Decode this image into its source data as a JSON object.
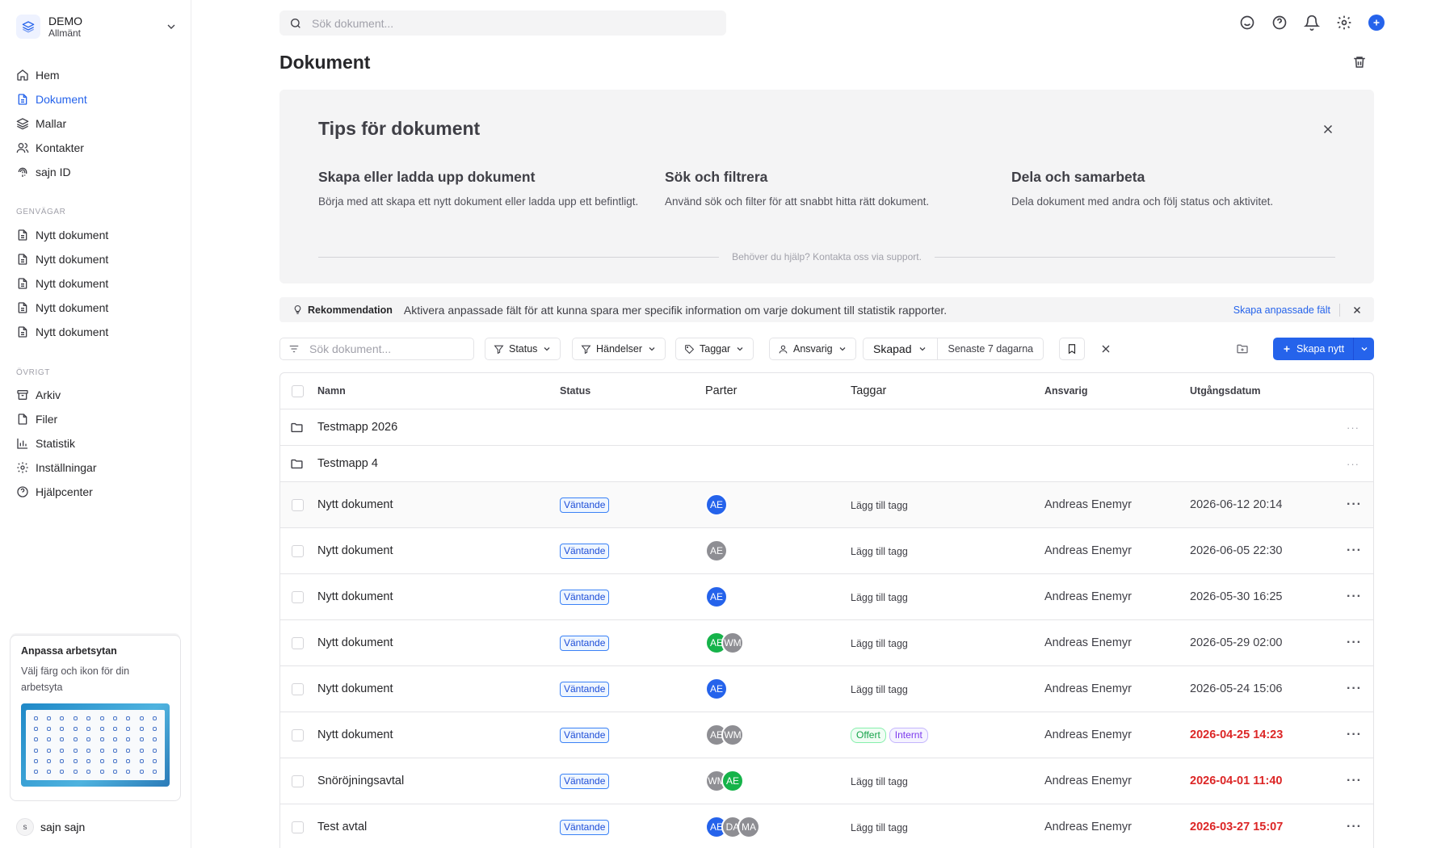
{
  "workspace": {
    "name": "DEMO",
    "sub": "Allmänt"
  },
  "nav": [
    {
      "label": "Hem",
      "icon": "home-icon"
    },
    {
      "label": "Dokument",
      "icon": "document-icon",
      "active": true
    },
    {
      "label": "Mallar",
      "icon": "layers-icon"
    },
    {
      "label": "Kontakter",
      "icon": "contacts-icon"
    },
    {
      "label": "sajn ID",
      "icon": "fingerprint-icon"
    }
  ],
  "shortcuts": {
    "label": "GENVÄGAR",
    "items": [
      "Nytt dokument",
      "Nytt dokument",
      "Nytt dokument",
      "Nytt dokument",
      "Nytt dokument"
    ]
  },
  "other": {
    "label": "ÖVRIGT",
    "items": [
      {
        "label": "Arkiv",
        "icon": "archive-icon"
      },
      {
        "label": "Filer",
        "icon": "file-icon"
      },
      {
        "label": "Statistik",
        "icon": "chart-icon"
      },
      {
        "label": "Inställningar",
        "icon": "gear-icon"
      },
      {
        "label": "Hjälpcenter",
        "icon": "help-icon"
      }
    ]
  },
  "customize_card": {
    "title": "Anpassa arbetsytan",
    "desc": "Välj färg och ikon för din arbetsyta"
  },
  "user": {
    "initial": "s",
    "name": "sajn sajn"
  },
  "top_search": {
    "placeholder": "Sök dokument..."
  },
  "page_title": "Dokument",
  "tips": {
    "title": "Tips för dokument",
    "columns": [
      {
        "title": "Skapa eller ladda upp dokument",
        "text": "Börja med att skapa ett nytt dokument eller ladda upp ett befintligt."
      },
      {
        "title": "Sök och filtrera",
        "text": "Använd sök och filter för att snabbt hitta rätt dokument."
      },
      {
        "title": "Dela och samarbeta",
        "text": "Dela dokument med andra och följ status och aktivitet."
      }
    ],
    "help": "Behöver du hjälp? Kontakta oss via support."
  },
  "recommendation": {
    "label": "Rekommendation",
    "message": "Aktivera anpassade fält för att kunna spara mer specifik information om varje dokument till statistik rapporter.",
    "link": "Skapa anpassade fält"
  },
  "filters": {
    "search_placeholder": "Sök dokument...",
    "status": "Status",
    "events": "Händelser",
    "tags": "Taggar",
    "responsible": "Ansvarig",
    "created": "Skapad",
    "range": "Senaste 7 dagarna",
    "create": "Skapa nytt"
  },
  "table": {
    "headers": {
      "name": "Namn",
      "status": "Status",
      "parties": "Parter",
      "tags": "Taggar",
      "responsible": "Ansvarig",
      "expiry": "Utgångsdatum"
    },
    "folders": [
      "Testmapp 2026",
      "Testmapp 4"
    ],
    "rows": [
      {
        "name": "Nytt dokument",
        "status": "Väntande",
        "parties": [
          {
            "i": "AE",
            "c": "blue"
          }
        ],
        "tags": [],
        "add_tag": "Lägg till tagg",
        "responsible": "Andreas Enemyr",
        "expiry": "2026-06-12 20:14",
        "overdue": false
      },
      {
        "name": "Nytt dokument",
        "status": "Väntande",
        "parties": [
          {
            "i": "AE",
            "c": "gray"
          }
        ],
        "tags": [],
        "add_tag": "Lägg till tagg",
        "responsible": "Andreas Enemyr",
        "expiry": "2026-06-05 22:30",
        "overdue": false
      },
      {
        "name": "Nytt dokument",
        "status": "Väntande",
        "parties": [
          {
            "i": "AE",
            "c": "blue"
          }
        ],
        "tags": [],
        "add_tag": "Lägg till tagg",
        "responsible": "Andreas Enemyr",
        "expiry": "2026-05-30 16:25",
        "overdue": false
      },
      {
        "name": "Nytt dokument",
        "status": "Väntande",
        "parties": [
          {
            "i": "AE",
            "c": "green"
          },
          {
            "i": "WM",
            "c": "gray"
          }
        ],
        "tags": [],
        "add_tag": "Lägg till tagg",
        "responsible": "Andreas Enemyr",
        "expiry": "2026-05-29 02:00",
        "overdue": false
      },
      {
        "name": "Nytt dokument",
        "status": "Väntande",
        "parties": [
          {
            "i": "AE",
            "c": "blue"
          }
        ],
        "tags": [],
        "add_tag": "Lägg till tagg",
        "responsible": "Andreas Enemyr",
        "expiry": "2026-05-24 15:06",
        "overdue": false
      },
      {
        "name": "Nytt dokument",
        "status": "Väntande",
        "parties": [
          {
            "i": "AE",
            "c": "gray"
          },
          {
            "i": "WM",
            "c": "gray"
          }
        ],
        "tags": [
          {
            "t": "Offert",
            "c": "green"
          },
          {
            "t": "Internt",
            "c": "purple"
          }
        ],
        "add_tag": "",
        "responsible": "Andreas Enemyr",
        "expiry": "2026-04-25 14:23",
        "overdue": true
      },
      {
        "name": "Snöröjningsavtal",
        "status": "Väntande",
        "parties": [
          {
            "i": "WM",
            "c": "gray"
          },
          {
            "i": "AE",
            "c": "green"
          }
        ],
        "tags": [],
        "add_tag": "Lägg till tagg",
        "responsible": "Andreas Enemyr",
        "expiry": "2026-04-01 11:40",
        "overdue": true
      },
      {
        "name": "Test avtal",
        "status": "Väntande",
        "parties": [
          {
            "i": "AE",
            "c": "blue"
          },
          {
            "i": "DA",
            "c": "gray"
          },
          {
            "i": "MA",
            "c": "gray"
          }
        ],
        "tags": [],
        "add_tag": "Lägg till tagg",
        "responsible": "Andreas Enemyr",
        "expiry": "2026-03-27 15:07",
        "overdue": true
      }
    ]
  },
  "colors": {
    "accent": "#2563eb",
    "overdue": "#dc2626"
  }
}
